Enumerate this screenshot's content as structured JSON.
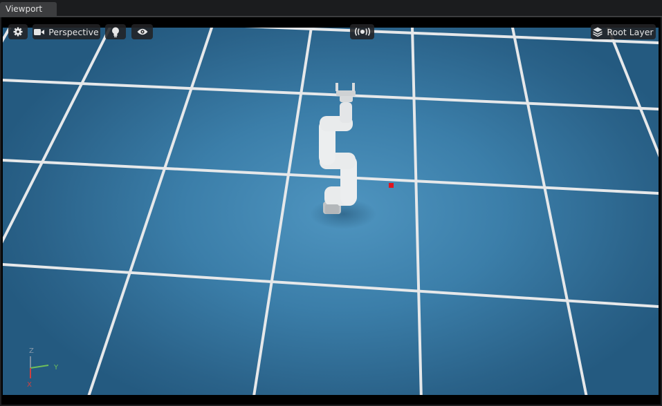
{
  "tabs": [
    {
      "label": "Viewport",
      "active": true
    }
  ],
  "toolbar": {
    "camera_label": "Perspective",
    "layer_label": "Root Layer",
    "settings_icon": "gear-icon",
    "camera_icon": "video-camera-icon",
    "lighting_icon": "lightbulb-icon",
    "visibility_icon": "eye-icon",
    "stream_icon": "broadcast-icon",
    "layers_icon": "layers-icon"
  },
  "axes": {
    "z": "Z",
    "y": "Y",
    "x": "X"
  },
  "colors": {
    "background": "#2f6e98",
    "grid_lines": "#e8e8e8",
    "robot": "#eceeef",
    "target_marker": "#e0141e",
    "axis_z": "#7a8da0",
    "axis_y": "#6fbf5a",
    "axis_x": "#d04040"
  }
}
